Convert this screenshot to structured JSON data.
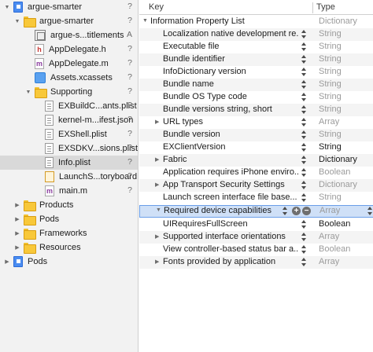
{
  "navigator": {
    "items": [
      {
        "label": "argue-smarter",
        "badge": "?"
      },
      {
        "label": "argue-smarter",
        "badge": "?"
      },
      {
        "label": "argue-s...titlements",
        "badge": "A"
      },
      {
        "label": "AppDelegate.h",
        "badge": "?"
      },
      {
        "label": "AppDelegate.m",
        "badge": "?"
      },
      {
        "label": "Assets.xcassets",
        "badge": "?"
      },
      {
        "label": "Supporting",
        "badge": "?"
      },
      {
        "label": "EXBuildC...ants.plist",
        "badge": "?"
      },
      {
        "label": "kernel-m...ifest.json",
        "badge": "?"
      },
      {
        "label": "EXShell.plist",
        "badge": "?"
      },
      {
        "label": "EXSDKV...sions.plist",
        "badge": "?"
      },
      {
        "label": "Info.plist",
        "badge": "?"
      },
      {
        "label": "LaunchS...toryboard",
        "badge": "?"
      },
      {
        "label": "main.m",
        "badge": "?"
      },
      {
        "label": "Products",
        "badge": ""
      },
      {
        "label": "Pods",
        "badge": ""
      },
      {
        "label": "Frameworks",
        "badge": ""
      },
      {
        "label": "Resources",
        "badge": ""
      },
      {
        "label": "Pods",
        "badge": ""
      }
    ]
  },
  "editor": {
    "header": {
      "key": "Key",
      "type": "Type"
    },
    "rows": [
      {
        "key": "Information Property List",
        "type": "Dictionary"
      },
      {
        "key": "Localization native development re...",
        "type": "String"
      },
      {
        "key": "Executable file",
        "type": "String"
      },
      {
        "key": "Bundle identifier",
        "type": "String"
      },
      {
        "key": "InfoDictionary version",
        "type": "String"
      },
      {
        "key": "Bundle name",
        "type": "String"
      },
      {
        "key": "Bundle OS Type code",
        "type": "String"
      },
      {
        "key": "Bundle versions string, short",
        "type": "String"
      },
      {
        "key": "URL types",
        "type": "Array"
      },
      {
        "key": "Bundle version",
        "type": "String"
      },
      {
        "key": "EXClientVersion",
        "type": "String"
      },
      {
        "key": "Fabric",
        "type": "Dictionary"
      },
      {
        "key": "Application requires iPhone enviro...",
        "type": "Boolean"
      },
      {
        "key": "App Transport Security Settings",
        "type": "Dictionary"
      },
      {
        "key": "Launch screen interface file base...",
        "type": "String"
      },
      {
        "key": "Required device capabilities",
        "type": "Array"
      },
      {
        "key": "UIRequiresFullScreen",
        "type": "Boolean"
      },
      {
        "key": "Supported interface orientations",
        "type": "Array"
      },
      {
        "key": "View controller-based status bar a...",
        "type": "Boolean"
      },
      {
        "key": "Fonts provided by application",
        "type": "Array"
      }
    ],
    "add_symbol": "+",
    "remove_symbol": "−"
  }
}
